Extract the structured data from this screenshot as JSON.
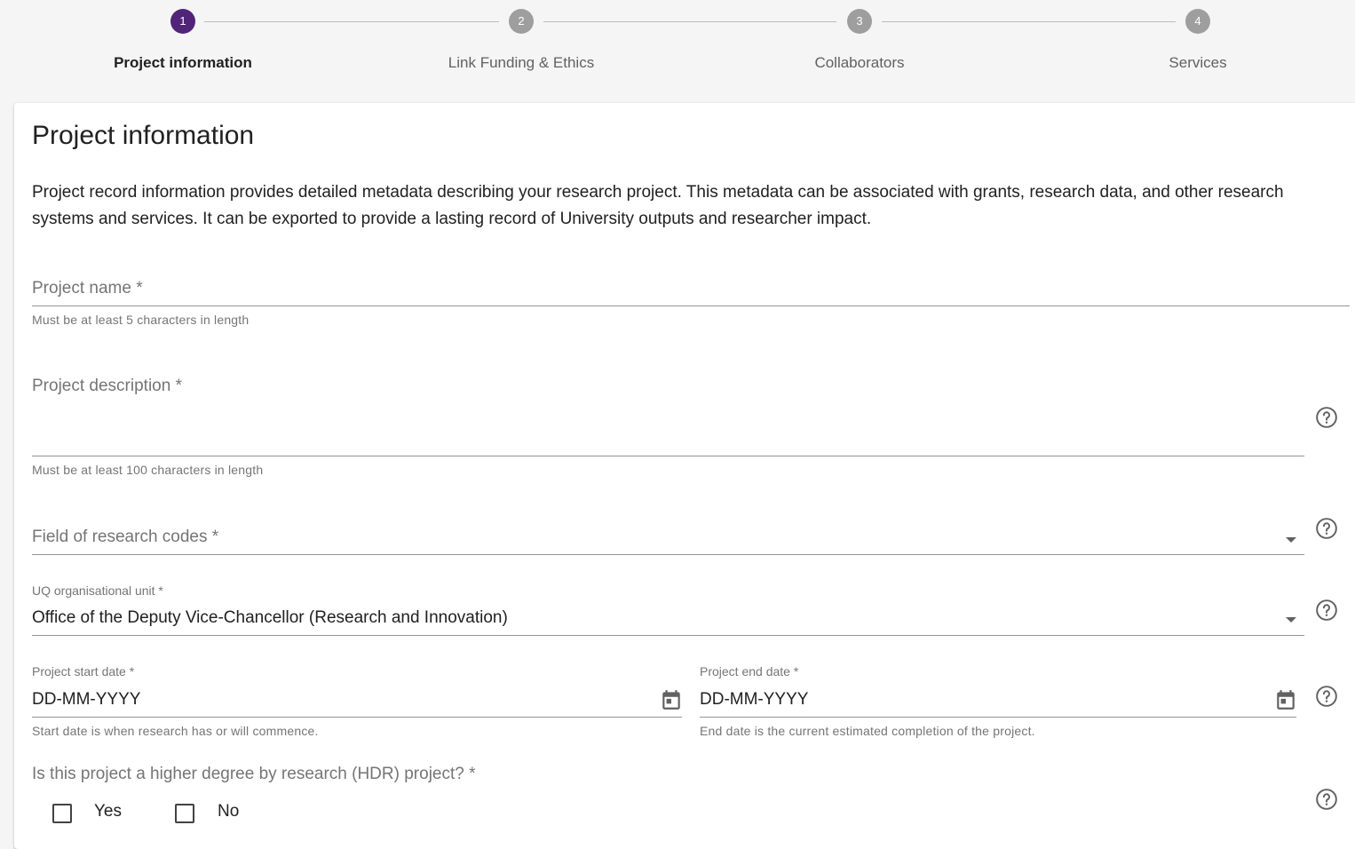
{
  "stepper": {
    "steps": [
      {
        "number": "1",
        "label": "Project information"
      },
      {
        "number": "2",
        "label": "Link Funding & Ethics"
      },
      {
        "number": "3",
        "label": "Collaborators"
      },
      {
        "number": "4",
        "label": "Services"
      }
    ],
    "active_step": "1"
  },
  "form": {
    "title": "Project information",
    "intro": "Project record information provides detailed metadata describing your research project. This metadata can be associated with grants, research data, and other research systems and services. It can be exported to provide a lasting record of University outputs and researcher impact.",
    "project_name": {
      "label": "Project name *",
      "helper": "Must be at least 5 characters in length"
    },
    "project_description": {
      "label": "Project description *",
      "helper": "Must be at least 100 characters in length"
    },
    "field_of_research": {
      "label": "Field of research codes *"
    },
    "org_unit": {
      "label": "UQ organisational unit *",
      "value": "Office of the Deputy Vice-Chancellor (Research and Innovation)"
    },
    "start_date": {
      "label": "Project start date *",
      "value": "DD-MM-YYYY",
      "helper": "Start date is when research has or will commence."
    },
    "end_date": {
      "label": "Project end date *",
      "value": "DD-MM-YYYY",
      "helper": "End date is the current estimated completion of the project."
    },
    "hdr": {
      "question": "Is this project a higher degree by research (HDR) project? *",
      "options": [
        "Yes",
        "No"
      ]
    }
  },
  "colors": {
    "accent": "#51247a",
    "inactive_step": "#9e9e9e"
  },
  "icons": [
    "help-icon",
    "calendar-icon",
    "dropdown-arrow-icon",
    "checkbox-icon"
  ]
}
